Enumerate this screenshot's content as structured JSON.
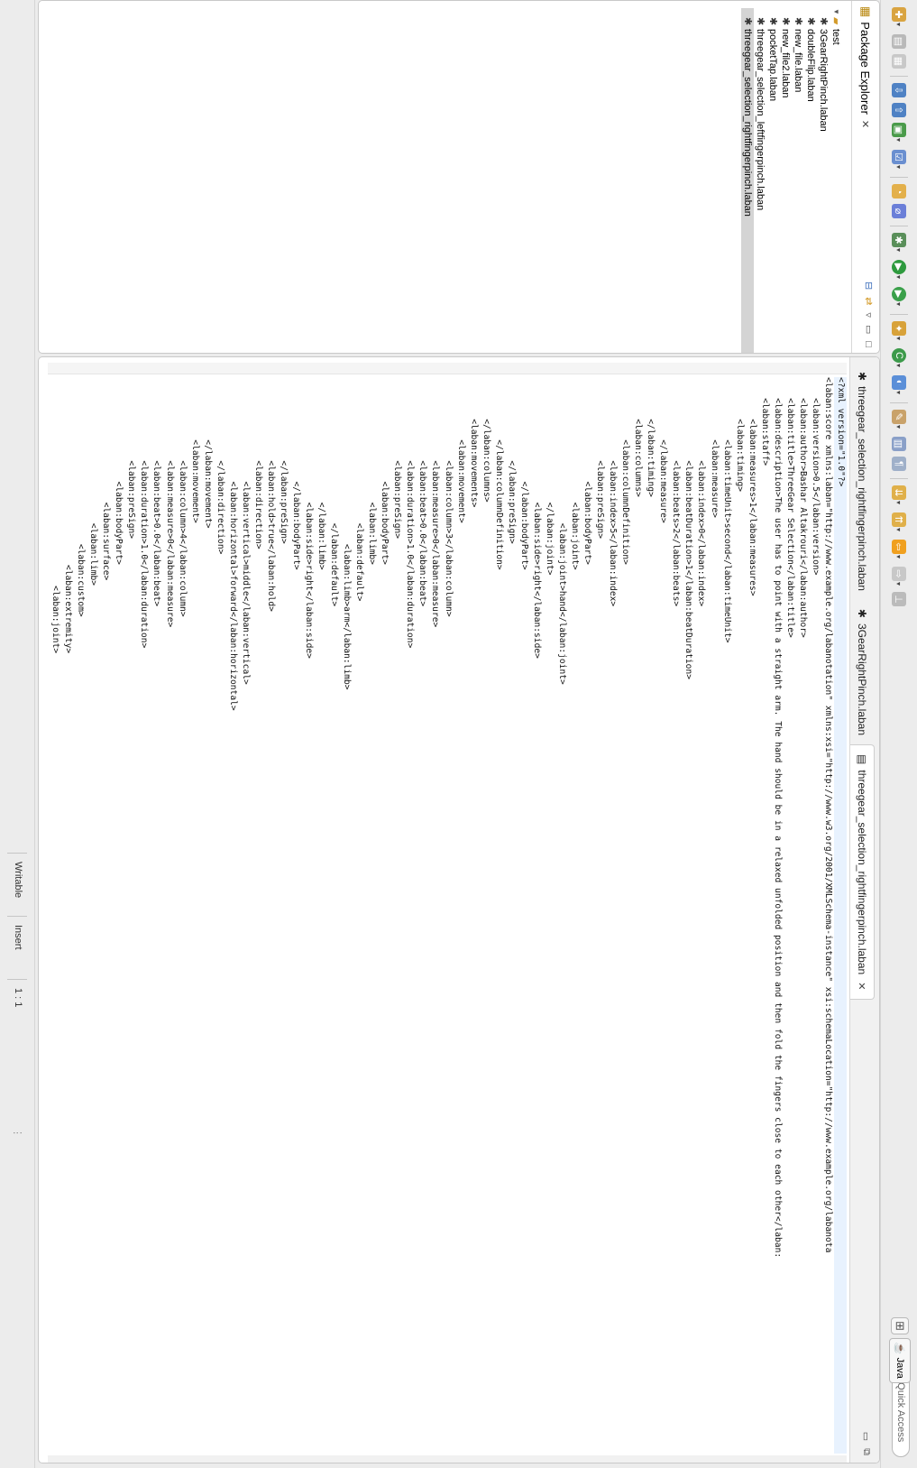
{
  "perspective": {
    "quick_access": "Quick Access",
    "java_label": "Java"
  },
  "package_explorer": {
    "title": "Package Explorer",
    "project": "test",
    "files": [
      "3GearRightPinch.laban",
      "doubleFlip.laban",
      "new_file.laban",
      "new_file2.laban",
      "pocketTap.laban",
      "threegear_selection_leftfingerpinch.laban",
      "threegear_selection_rightfingerpinch.laban"
    ],
    "selected_index": 6
  },
  "editor": {
    "tabs": [
      {
        "label": "threegear_selection_rightfingerpinch.laban",
        "active": false
      },
      {
        "label": "3GearRightPinch.laban",
        "active": false
      },
      {
        "label": "threegear_selection_rightfingerpinch.laban",
        "active": true
      }
    ],
    "lines": [
      "<?xml version=\"1.0\"?>",
      "<laban:score xmlns:laban=\"http://www.example.org/labanotation\" xmlns:xsi=\"http://www.w3.org/2001/XMLSchema-instance\" xsi:schemaLocation=\"http://www.example.org/labanota",
      "    <laban:version>0.5</laban:version>",
      "    <laban:author>Bashar Altakrouri</laban:author>",
      "    <laban:title>ThreeGear Selection</laban:title>",
      "    <laban:description>The user has to point with a straight arm. The hand should be in a relaxed unfolded position and then fold the fingers close to each other</laban:",
      "    <laban:staff>",
      "        <laban:measures>1</laban:measures>",
      "        <laban:timing>",
      "            <laban:timeUnit>second</laban:timeUnit>",
      "            <laban:measure>",
      "                <laban:index>0</laban:index>",
      "                <laban:beatDuration>1</laban:beatDuration>",
      "                <laban:beats>2</laban:beats>",
      "            </laban:measure>",
      "        </laban:timing>",
      "        <laban:columns>",
      "            <laban:columnDefinition>",
      "                <laban:index>5</laban:index>",
      "                <laban:preSign>",
      "                    <laban:bodyPart>",
      "                        <laban:joint>",
      "                            <laban:joint>hand</laban:joint>",
      "                        </laban:joint>",
      "                        <laban:side>right</laban:side>",
      "                    </laban:bodyPart>",
      "                </laban:preSign>",
      "            </laban:columnDefinition>",
      "        </laban:columns>",
      "        <laban:movements>",
      "            <laban:movement>",
      "                <laban:column>3</laban:column>",
      "                <laban:measure>0</laban:measure>",
      "                <laban:beat>0.0</laban:beat>",
      "                <laban:duration>1.0</laban:duration>",
      "                <laban:preSign>",
      "                    <laban:bodyPart>",
      "                        <laban:limb>",
      "                            <laban:default>",
      "                                <laban:limb>arm</laban:limb>",
      "                            </laban:default>",
      "                        </laban:limb>",
      "                        <laban:side>right</laban:side>",
      "                    </laban:bodyPart>",
      "                </laban:preSign>",
      "                <laban:hold>true</laban:hold>",
      "                <laban:direction>",
      "                    <laban:vertical>middle</laban:vertical>",
      "                    <laban:horizontal>forward</laban:horizontal>",
      "                </laban:direction>",
      "            </laban:movement>",
      "            <laban:movement>",
      "                <laban:column>4</laban:column>",
      "                <laban:measure>0</laban:measure>",
      "                <laban:beat>0.0</laban:beat>",
      "                <laban:duration>1.0</laban:duration>",
      "                <laban:preSign>",
      "                    <laban:bodyPart>",
      "                        <laban:surface>",
      "                            <laban:limb>",
      "                                <laban:custom>",
      "                                    <laban:extremity>",
      "                                        <laban:joint>"
    ]
  },
  "status": {
    "writable": "Writable",
    "insert": "Insert",
    "position": "1 : 1"
  }
}
